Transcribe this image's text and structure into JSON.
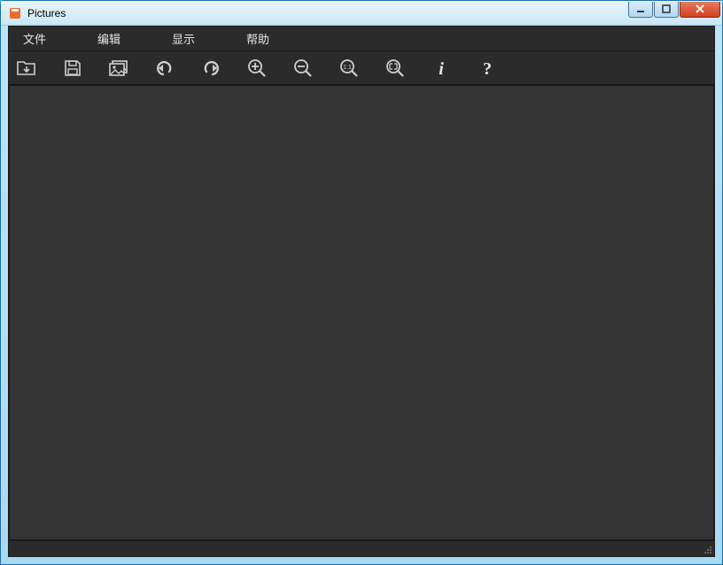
{
  "window": {
    "title": "Pictures"
  },
  "menu": {
    "file": "文件",
    "edit": "编辑",
    "view": "显示",
    "help": "帮助"
  },
  "toolbar": {
    "open_icon": "open-folder-icon",
    "save_icon": "save-icon",
    "image_icon": "image-icon",
    "undo_icon": "undo-icon",
    "redo_icon": "redo-icon",
    "zoom_in_icon": "zoom-in-icon",
    "zoom_out_icon": "zoom-out-icon",
    "zoom_11_icon": "zoom-1to1-icon",
    "zoom_fit_icon": "zoom-fit-icon",
    "info_icon": "info-icon",
    "help_icon": "help-icon"
  }
}
